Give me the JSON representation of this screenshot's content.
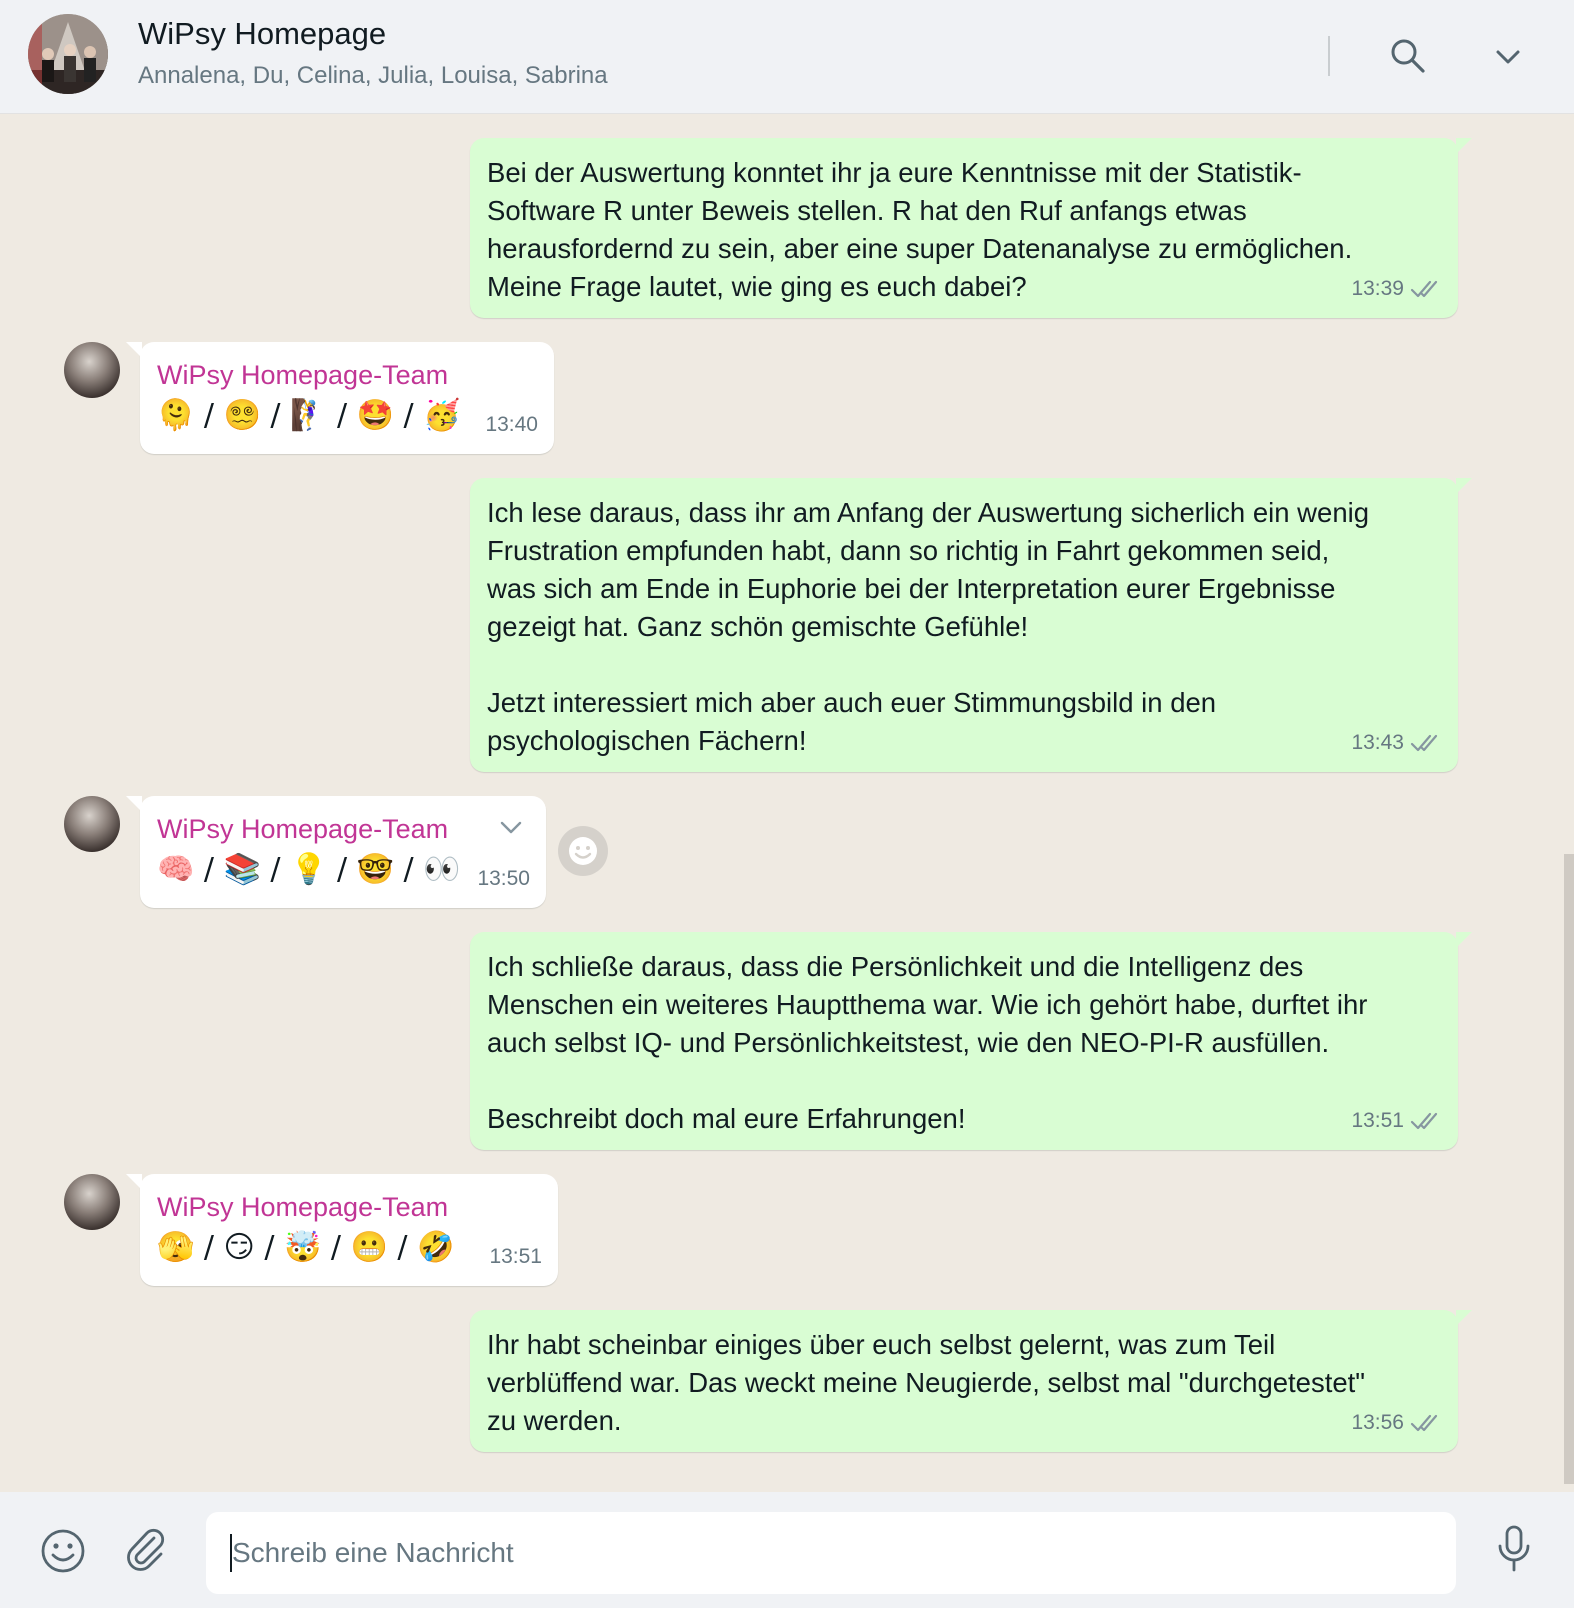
{
  "header": {
    "title": "WiPsy Homepage",
    "subtitle": "Annalena, Du, Celina, Julia, Louisa, Sabrina"
  },
  "messages": [
    {
      "direction": "out",
      "text": "Bei der Auswertung konntet ihr ja eure Kenntnisse mit der Statistik-\nSoftware R unter Beweis stellen. R hat den Ruf anfangs etwas\nherausfordernd zu sein, aber eine super Datenanalyse zu ermöglichen.\nMeine Frage lautet, wie ging es euch dabei?",
      "time": "13:39",
      "status": "read"
    },
    {
      "direction": "in",
      "sender": "WiPsy Homepage-Team",
      "text": "🫠 / 😵‍💫 / 🧗‍♀️ / 🤩 / 🥳",
      "time": "13:40"
    },
    {
      "direction": "out",
      "text": "Ich lese daraus, dass ihr am Anfang der Auswertung sicherlich ein wenig\nFrustration empfunden habt, dann so richtig in Fahrt gekommen seid,\nwas sich am Ende in Euphorie bei der Interpretation eurer Ergebnisse\ngezeigt hat. Ganz schön gemischte Gefühle!\n\nJetzt interessiert mich aber auch euer Stimmungsbild in den\npsychologischen Fächern!",
      "time": "13:43",
      "status": "read"
    },
    {
      "direction": "in",
      "sender": "WiPsy Homepage-Team",
      "text": "🧠 / 📚 / 💡 / 🤓 / 👀",
      "time": "13:50"
    },
    {
      "direction": "out",
      "text": "Ich schließe daraus, dass die Persönlichkeit und die Intelligenz des\nMenschen ein weiteres Hauptthema war. Wie ich gehört habe, durftet ihr\nauch selbst IQ- und Persönlichkeitstest, wie den NEO-PI-R ausfüllen.\n\nBeschreibt doch mal eure Erfahrungen!",
      "time": "13:51",
      "status": "read"
    },
    {
      "direction": "in",
      "sender": "WiPsy Homepage-Team",
      "text": "🫣 / 😏 / 🤯 / 😬 / 🤣",
      "time": "13:51"
    },
    {
      "direction": "out",
      "text": "Ihr habt scheinbar einiges über euch selbst gelernt, was zum Teil\nverblüffend war. Das weckt meine Neugierde, selbst mal \"durchgetestet\"\nzu werden.",
      "time": "13:56",
      "status": "read"
    }
  ],
  "composer": {
    "placeholder": "Schreib eine Nachricht"
  },
  "icons": {
    "header": [
      "search-icon",
      "chevron-down-icon"
    ],
    "footer": [
      "emoji-icon",
      "paperclip-icon",
      "microphone-icon"
    ]
  },
  "colors": {
    "chat_background": "#efeae2",
    "outgoing_bubble": "#d9fdd3",
    "incoming_bubble": "#ffffff",
    "sender_name": "#c13595",
    "header_background": "#f0f2f5"
  }
}
